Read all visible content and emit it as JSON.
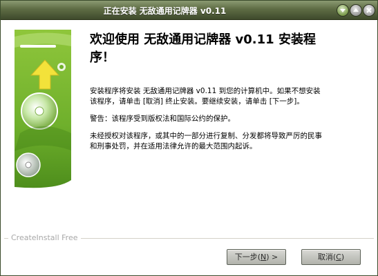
{
  "window": {
    "title": "正在安装 无敌通用记牌器 v0.11"
  },
  "content": {
    "heading_line1": "欢迎使用 无敌通用记牌器 v0.11 安装程",
    "heading_line2": "序！",
    "para1_line1": "安装程序将安装 无敌通用记牌器 v0.11 到您的计算机中。如果不想安装",
    "para1_line2": "该程序，请单击 [取消] 终止安装。要继续安装，请单击 [下一步]。",
    "para2": "警告：该程序受到版权法和国际公约的保护。",
    "para3_line1": "未经授权对该程序，或其中的一部分进行复制、分发都将导致严厉的民事",
    "para3_line2": "和刑事处罚，并在适用法律允许的最大范围内起诉。"
  },
  "footer": {
    "brand": "CreateInstall Free",
    "next": {
      "label": "下一步(",
      "hotkey": "N",
      "suffix": ") >"
    },
    "cancel": {
      "label": "取消(",
      "hotkey": "C",
      "suffix": ")"
    }
  }
}
